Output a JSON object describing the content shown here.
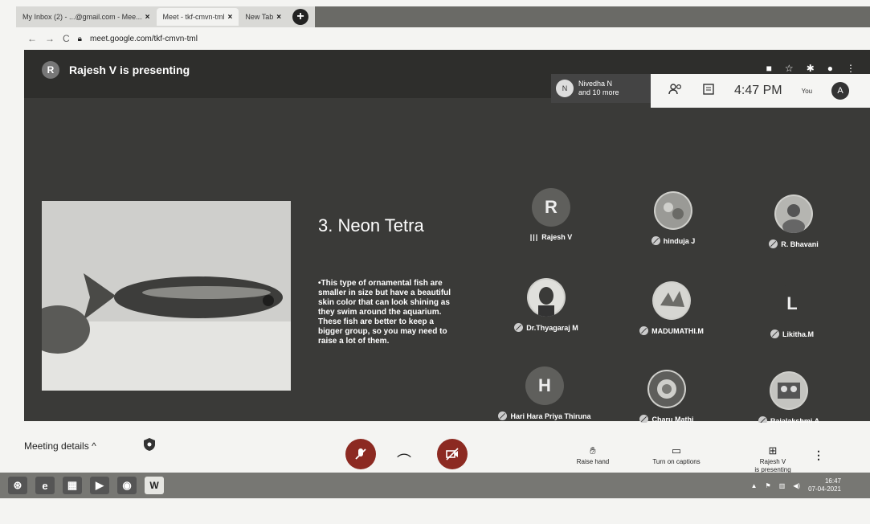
{
  "browser": {
    "tabs": [
      {
        "label": "My Inbox (2) - ...@gmail.com - Mee...",
        "close": "×"
      },
      {
        "label": "Meet - tkf-cmvn-tml",
        "close": "×"
      },
      {
        "label": "New Tab",
        "close": "×"
      }
    ],
    "url": "meet.google.com/tkf-cmvn-tml"
  },
  "meet": {
    "presenter_initial": "R",
    "presenting_label": "Rajesh V is presenting",
    "participants_chip": {
      "initial": "N",
      "line1": "Nivedha N",
      "line2": "and 10 more"
    },
    "clock": "4:47 PM",
    "you_label": "You",
    "self_initial": "A"
  },
  "slide": {
    "title": "3. Neon Tetra",
    "body": "•This type of ornamental fish are smaller in size but have a beautiful skin color that can look shining as they swim around the aquarium. These fish are better to keep a bigger group, so you may need to raise a lot of them."
  },
  "participants": [
    {
      "name": "Rajesh V",
      "initial": "R",
      "status": "speaking",
      "photo": false
    },
    {
      "name": "hinduja J",
      "initial": "",
      "status": "muted",
      "photo": true
    },
    {
      "name": "R. Bhavani",
      "initial": "",
      "status": "muted",
      "photo": true
    },
    {
      "name": "Dr.Thyagaraj M",
      "initial": "",
      "status": "muted",
      "photo": true
    },
    {
      "name": "MADUMATHI.M",
      "initial": "",
      "status": "muted",
      "photo": true
    },
    {
      "name": "Likitha.M",
      "initial": "L",
      "status": "muted",
      "photo": false
    },
    {
      "name": "Hari Hara Priya Thiruna",
      "initial": "H",
      "status": "muted",
      "photo": false
    },
    {
      "name": "Charu Mathi",
      "initial": "",
      "status": "muted",
      "photo": true
    },
    {
      "name": "Rajalakshmi A",
      "initial": "",
      "status": "muted",
      "photo": true
    }
  ],
  "controls": {
    "meeting_details": "Meeting details",
    "raise_hand": "Raise hand",
    "captions": "Turn on captions",
    "presenting_line1": "Rajesh V",
    "presenting_line2": "is presenting"
  },
  "taskbar": {
    "time": "16:47",
    "date": "07-04-2021"
  },
  "colors": {
    "meet_bg": "#3a3a38",
    "control_red": "#8c2a22"
  }
}
